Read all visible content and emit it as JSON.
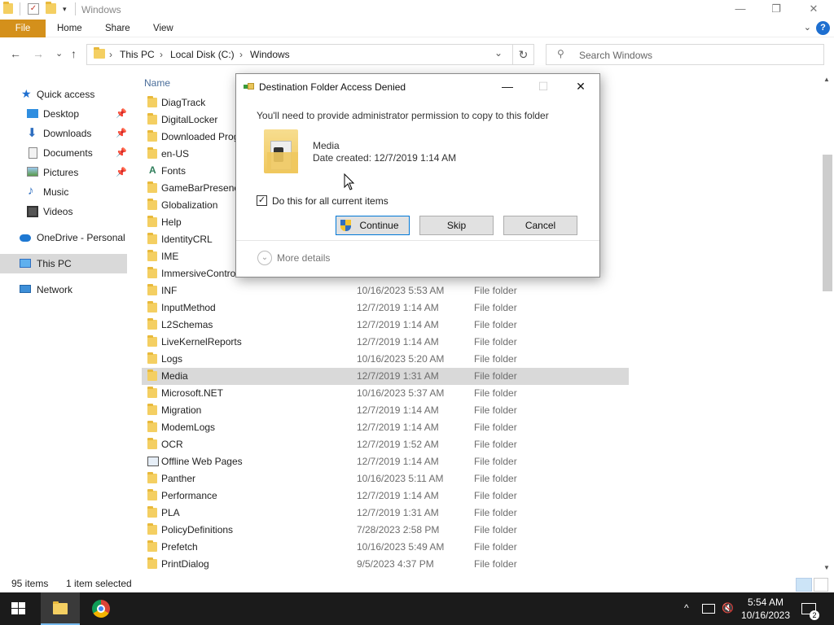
{
  "window": {
    "title": "Windows",
    "minimize": "—",
    "maximize": "❐",
    "close": "✕"
  },
  "ribbon": {
    "tabs": [
      "File",
      "Home",
      "Share",
      "View"
    ],
    "help": "?",
    "collapse": "⌄"
  },
  "address": {
    "back": "←",
    "forward": "→",
    "recent": "⌄",
    "up": "↑",
    "crumbs": [
      "This PC",
      "Local Disk (C:)",
      "Windows"
    ],
    "separator": "›",
    "dropdown": "⌄",
    "refresh": "↻",
    "search_placeholder": "Search Windows"
  },
  "sidebar": {
    "items": [
      {
        "label": "Quick access",
        "icon": "star-icon",
        "pinned": false
      },
      {
        "label": "Desktop",
        "icon": "desktop-icon",
        "pinned": true
      },
      {
        "label": "Downloads",
        "icon": "download-icon",
        "pinned": true
      },
      {
        "label": "Documents",
        "icon": "documents-icon",
        "pinned": true
      },
      {
        "label": "Pictures",
        "icon": "pictures-icon",
        "pinned": true
      },
      {
        "label": "Music",
        "icon": "music-icon",
        "pinned": false
      },
      {
        "label": "Videos",
        "icon": "videos-icon",
        "pinned": false
      },
      {
        "label": "OneDrive - Personal",
        "icon": "cloud-icon",
        "pinned": false
      },
      {
        "label": "This PC",
        "icon": "computer-icon",
        "pinned": false
      },
      {
        "label": "Network",
        "icon": "network-icon",
        "pinned": false
      }
    ]
  },
  "list": {
    "column_name": "Name",
    "rows": [
      {
        "name": "DiagTrack",
        "date": "",
        "type": ""
      },
      {
        "name": "DigitalLocker",
        "date": "",
        "type": ""
      },
      {
        "name": "Downloaded Prog",
        "date": "",
        "type": ""
      },
      {
        "name": "en-US",
        "date": "",
        "type": ""
      },
      {
        "name": "Fonts",
        "date": "",
        "type": ""
      },
      {
        "name": "GameBarPresenc",
        "date": "",
        "type": ""
      },
      {
        "name": "Globalization",
        "date": "",
        "type": ""
      },
      {
        "name": "Help",
        "date": "",
        "type": ""
      },
      {
        "name": "IdentityCRL",
        "date": "",
        "type": ""
      },
      {
        "name": "IME",
        "date": "",
        "type": ""
      },
      {
        "name": "ImmersiveControlPanel",
        "date": "",
        "type": ""
      },
      {
        "name": "INF",
        "date": "10/16/2023 5:53 AM",
        "type": "File folder"
      },
      {
        "name": "InputMethod",
        "date": "12/7/2019 1:14 AM",
        "type": "File folder"
      },
      {
        "name": "L2Schemas",
        "date": "12/7/2019 1:14 AM",
        "type": "File folder"
      },
      {
        "name": "LiveKernelReports",
        "date": "12/7/2019 1:14 AM",
        "type": "File folder"
      },
      {
        "name": "Logs",
        "date": "10/16/2023 5:20 AM",
        "type": "File folder"
      },
      {
        "name": "Media",
        "date": "12/7/2019 1:31 AM",
        "type": "File folder"
      },
      {
        "name": "Microsoft.NET",
        "date": "10/16/2023 5:37 AM",
        "type": "File folder"
      },
      {
        "name": "Migration",
        "date": "12/7/2019 1:14 AM",
        "type": "File folder"
      },
      {
        "name": "ModemLogs",
        "date": "12/7/2019 1:14 AM",
        "type": "File folder"
      },
      {
        "name": "OCR",
        "date": "12/7/2019 1:52 AM",
        "type": "File folder"
      },
      {
        "name": "Offline Web Pages",
        "date": "12/7/2019 1:14 AM",
        "type": "File folder"
      },
      {
        "name": "Panther",
        "date": "10/16/2023 5:11 AM",
        "type": "File folder"
      },
      {
        "name": "Performance",
        "date": "12/7/2019 1:14 AM",
        "type": "File folder"
      },
      {
        "name": "PLA",
        "date": "12/7/2019 1:31 AM",
        "type": "File folder"
      },
      {
        "name": "PolicyDefinitions",
        "date": "7/28/2023 2:58 PM",
        "type": "File folder"
      },
      {
        "name": "Prefetch",
        "date": "10/16/2023 5:49 AM",
        "type": "File folder"
      },
      {
        "name": "PrintDialog",
        "date": "9/5/2023 4:37 PM",
        "type": "File folder"
      }
    ]
  },
  "status": {
    "items": "95 items",
    "selected": "1 item selected"
  },
  "dialog": {
    "title": "Destination Folder Access Denied",
    "minimize": "—",
    "maximize": "☐",
    "close": "✕",
    "message": "You'll need to provide administrator permission to copy to this folder",
    "file_name": "Media",
    "date_created": "Date created: 12/7/2019 1:14 AM",
    "checkbox_label": "Do this for all current items",
    "checkbox_mark": "✓",
    "continue": "Continue",
    "skip": "Skip",
    "cancel": "Cancel",
    "more_details": "More details",
    "more_icon": "⌄"
  },
  "taskbar": {
    "time": "5:54 AM",
    "date": "10/16/2023",
    "notification_count": "2",
    "tray_up": "^"
  },
  "colors": {
    "file_tab": "#d4901b",
    "accent": "#0078d7",
    "folder": "#f4cf62"
  }
}
